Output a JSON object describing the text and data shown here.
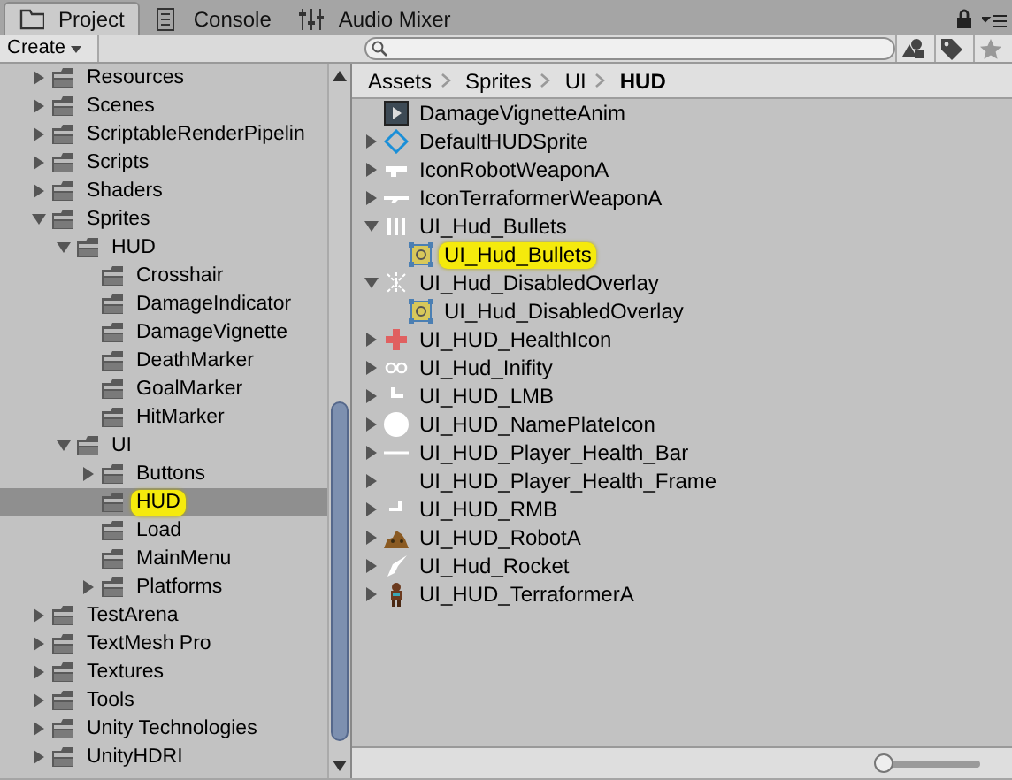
{
  "tabs": [
    {
      "label": "Project",
      "kind": "project",
      "selected": true
    },
    {
      "label": "Console",
      "kind": "console",
      "selected": false
    },
    {
      "label": "Audio Mixer",
      "kind": "mixer",
      "selected": false
    }
  ],
  "toolbar": {
    "create_button": "Create"
  },
  "folder_tree": [
    {
      "label": "Resources",
      "expanded": false,
      "selected": false
    },
    {
      "label": "Scenes",
      "expanded": false,
      "selected": false
    },
    {
      "label": "ScriptableRenderPipelin",
      "expanded": false,
      "selected": false
    },
    {
      "label": "Scripts",
      "expanded": false,
      "selected": false
    },
    {
      "label": "Shaders",
      "expanded": false,
      "selected": false
    },
    {
      "label": "Sprites",
      "expanded": true,
      "selected": false,
      "children": [
        {
          "label": "HUD",
          "expanded": true,
          "selected": false,
          "children": [
            {
              "label": "Crosshair",
              "selected": false
            },
            {
              "label": "DamageIndicator",
              "selected": false
            },
            {
              "label": "DamageVignette",
              "selected": false
            },
            {
              "label": "DeathMarker",
              "selected": false
            },
            {
              "label": "GoalMarker",
              "selected": false
            },
            {
              "label": "HitMarker",
              "selected": false
            }
          ]
        },
        {
          "label": "UI",
          "expanded": true,
          "selected": false,
          "children": [
            {
              "label": "Buttons",
              "expanded": false,
              "selected": false
            },
            {
              "label": "HUD",
              "selected": true
            },
            {
              "label": "Load",
              "selected": false
            },
            {
              "label": "MainMenu",
              "selected": false
            },
            {
              "label": "Platforms",
              "expanded": false,
              "selected": false
            }
          ]
        }
      ]
    },
    {
      "label": "TestArena",
      "expanded": false,
      "selected": false
    },
    {
      "label": "TextMesh Pro",
      "expanded": false,
      "selected": false
    },
    {
      "label": "Textures",
      "expanded": false,
      "selected": false
    },
    {
      "label": "Tools",
      "expanded": false,
      "selected": false
    },
    {
      "label": "Unity Technologies",
      "expanded": false,
      "selected": false
    },
    {
      "label": "UnityHDRI",
      "expanded": false,
      "selected": false
    }
  ],
  "breadcrumb": [
    {
      "label": "Assets",
      "current": false
    },
    {
      "label": "Sprites",
      "current": false
    },
    {
      "label": "UI",
      "current": false
    },
    {
      "label": "HUD",
      "current": true
    }
  ],
  "assets": [
    {
      "label": "DamageVignetteAnim",
      "kind": "animation",
      "selected": false
    },
    {
      "label": "DefaultHUDSprite",
      "kind": "diamond",
      "expanded": false,
      "selected": false
    },
    {
      "label": "IconRobotWeaponA",
      "kind": "gun",
      "expanded": false,
      "selected": false
    },
    {
      "label": "IconTerraformerWeaponA",
      "kind": "rifle",
      "expanded": false,
      "selected": false
    },
    {
      "label": "UI_Hud_Bullets",
      "kind": "bars",
      "expanded": true,
      "selected": false,
      "children": [
        {
          "label": "UI_Hud_Bullets",
          "kind": "subsprite",
          "selected": true
        }
      ]
    },
    {
      "label": "UI_Hud_DisabledOverlay",
      "kind": "sparkle",
      "expanded": true,
      "selected": false,
      "children": [
        {
          "label": "UI_Hud_DisabledOverlay",
          "kind": "subsprite",
          "selected": false
        }
      ]
    },
    {
      "label": "UI_HUD_HealthIcon",
      "kind": "cross",
      "expanded": false,
      "selected": false
    },
    {
      "label": "UI_Hud_Inifity",
      "kind": "infinity",
      "expanded": false,
      "selected": false
    },
    {
      "label": "UI_HUD_LMB",
      "kind": "lmb",
      "expanded": false,
      "selected": false
    },
    {
      "label": "UI_HUD_NamePlateIcon",
      "kind": "circle",
      "expanded": false,
      "selected": false
    },
    {
      "label": "UI_HUD_Player_Health_Bar",
      "kind": "line",
      "expanded": false,
      "selected": false
    },
    {
      "label": "UI_HUD_Player_Health_Frame",
      "kind": "blank",
      "expanded": false,
      "selected": false
    },
    {
      "label": "UI_HUD_RMB",
      "kind": "rmb",
      "expanded": false,
      "selected": false
    },
    {
      "label": "UI_HUD_RobotA",
      "kind": "robot",
      "expanded": false,
      "selected": false
    },
    {
      "label": "UI_Hud_Rocket",
      "kind": "rocket",
      "expanded": false,
      "selected": false
    },
    {
      "label": "UI_HUD_TerraformerA",
      "kind": "figure",
      "expanded": false,
      "selected": false
    }
  ],
  "icon_size_slider": {
    "level": 0.05
  }
}
